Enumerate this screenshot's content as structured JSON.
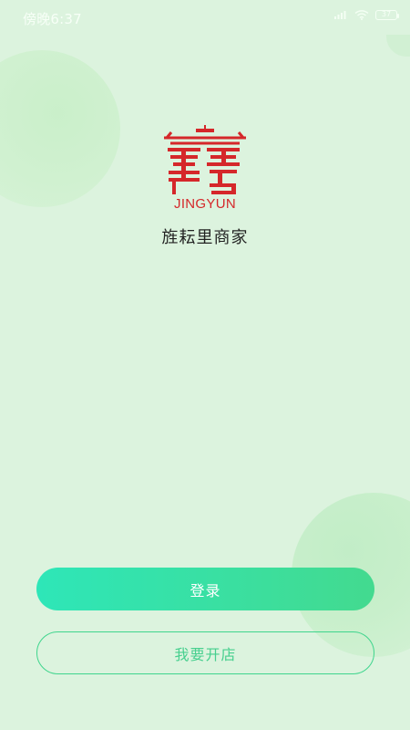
{
  "status_bar": {
    "time": "傍晚6:37",
    "battery_level": "37",
    "icons": [
      "signal-icon",
      "wifi-icon",
      "battery-icon"
    ]
  },
  "brand": {
    "logo_text": "JINGYUN",
    "app_name": "旌耘里商家",
    "logo_color": "#d5272a"
  },
  "actions": {
    "login_label": "登录",
    "open_store_label": "我要开店"
  }
}
